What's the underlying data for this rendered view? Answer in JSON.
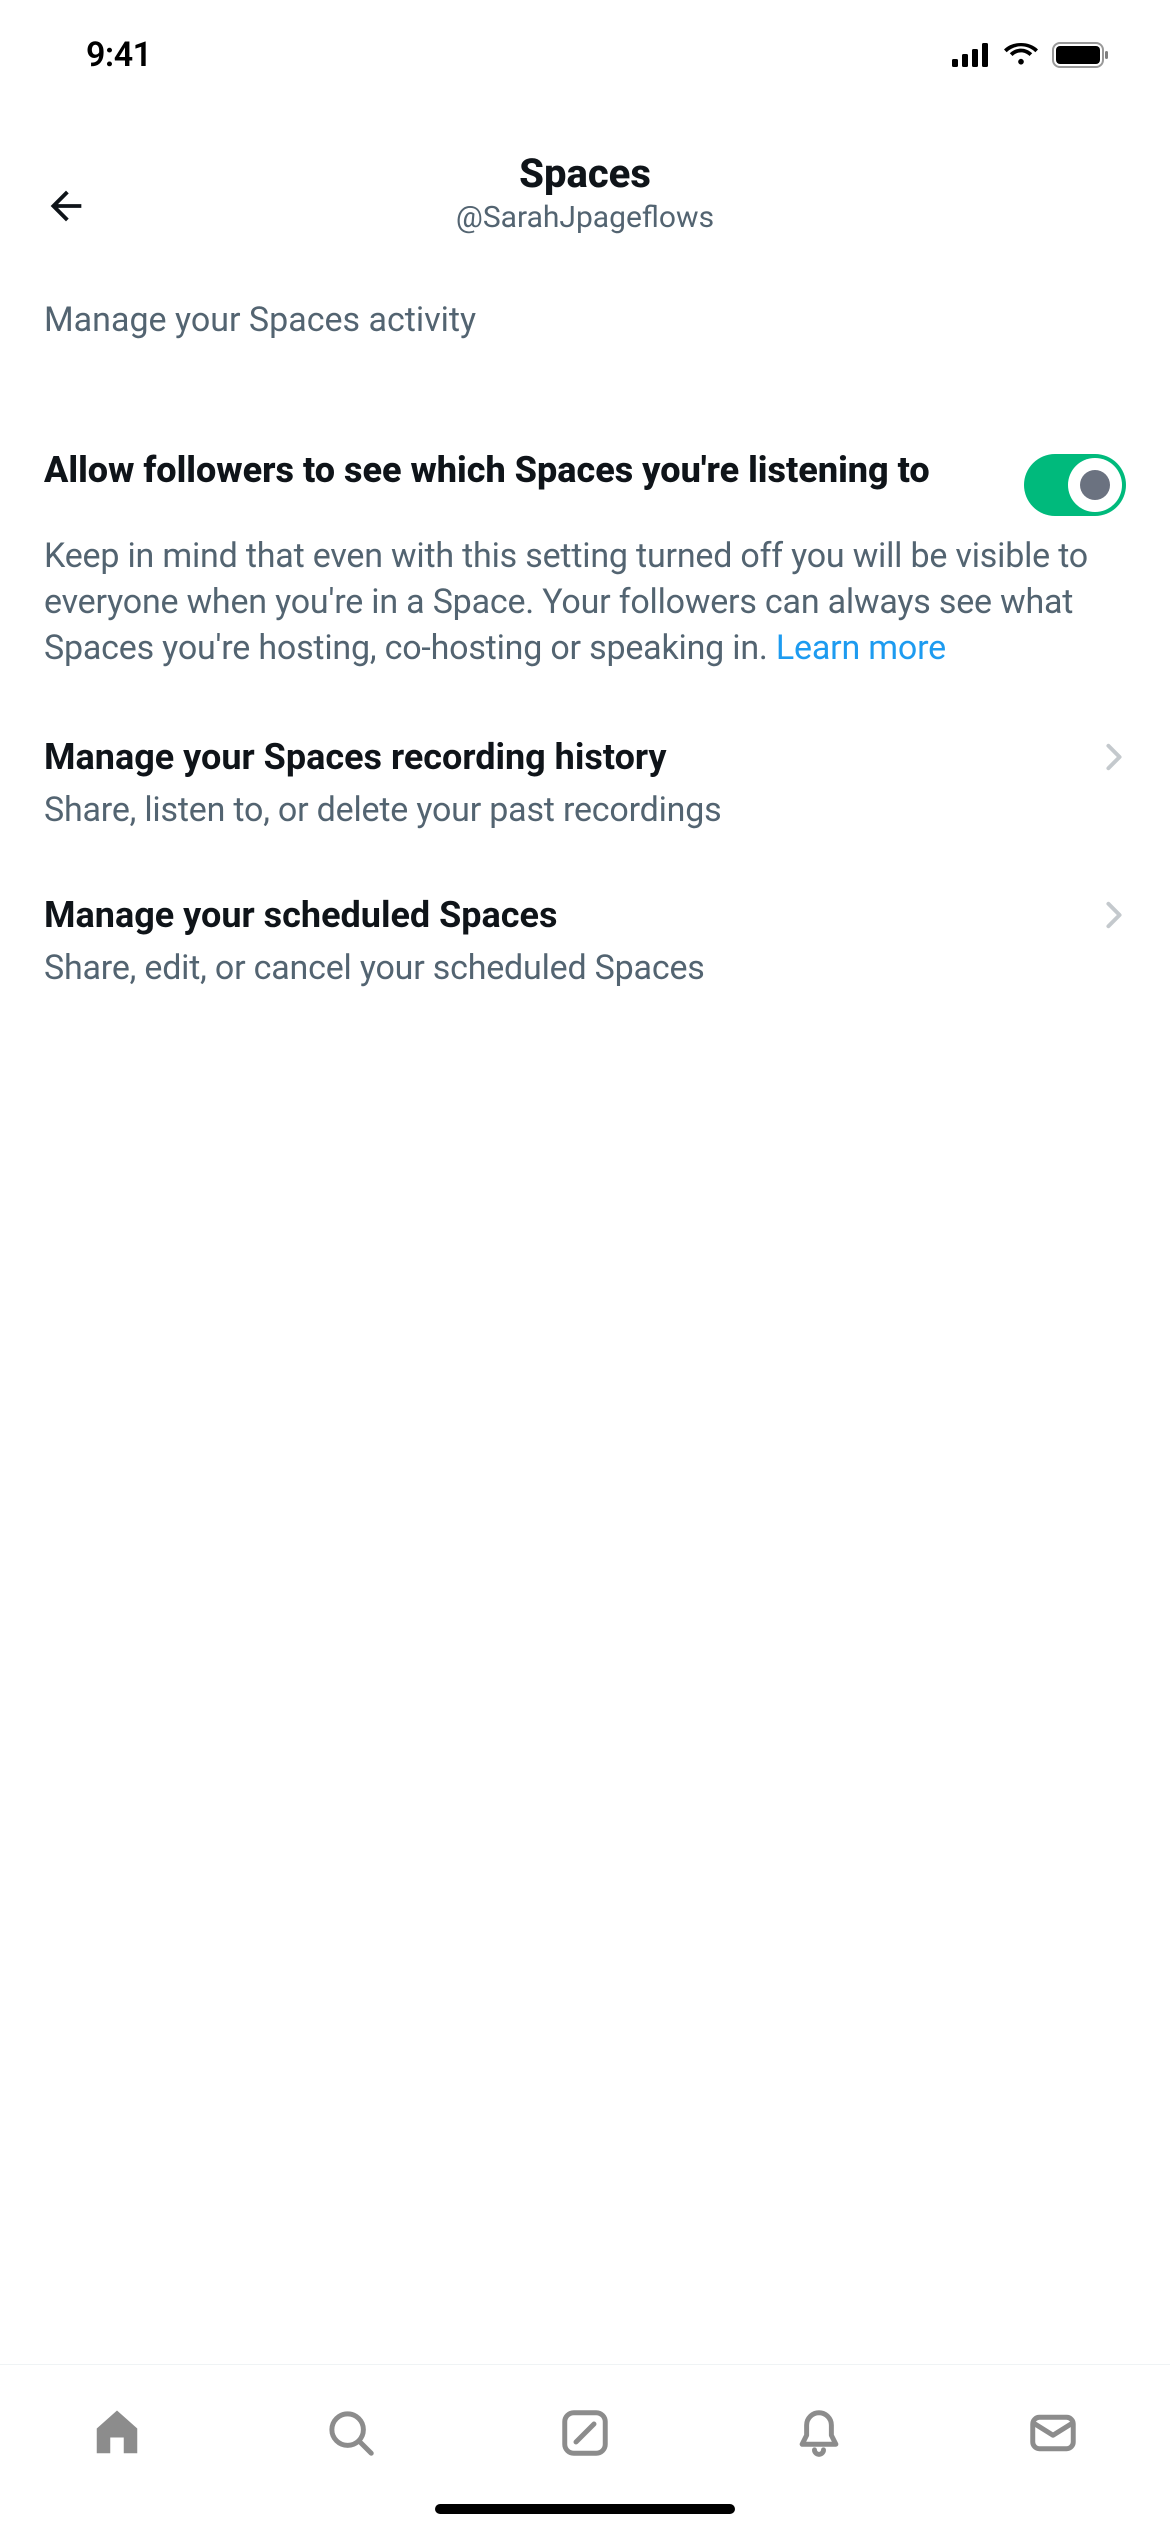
{
  "statusBar": {
    "time": "9:41"
  },
  "header": {
    "title": "Spaces",
    "subtitle": "@SarahJpageflows"
  },
  "intro": "Manage your Spaces activity",
  "settings": {
    "allowFollowers": {
      "title": "Allow followers to see which Spaces you're listening to",
      "description": "Keep in mind that even with this setting turned off you will be visible to everyone when you're in a Space. Your followers can always see what Spaces you're hosting, co-hosting or speaking in. ",
      "learnMore": "Learn more",
      "enabled": true
    }
  },
  "links": {
    "recordingHistory": {
      "title": "Manage your Spaces recording history",
      "description": "Share, listen to, or delete your past recordings"
    },
    "scheduledSpaces": {
      "title": "Manage your scheduled Spaces",
      "description": "Share, edit, or cancel your scheduled Spaces"
    }
  }
}
